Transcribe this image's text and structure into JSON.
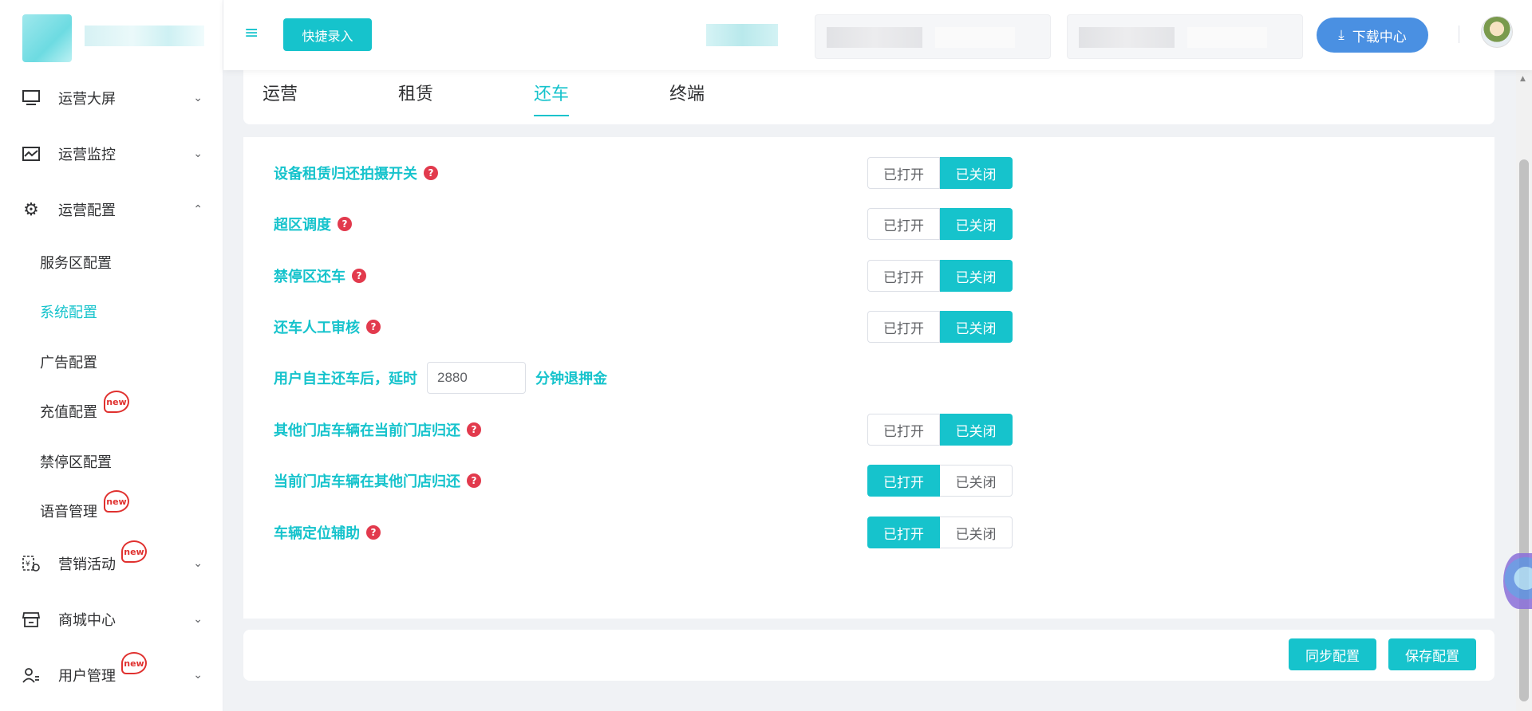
{
  "colors": {
    "accent": "#16c3cc",
    "download": "#4a90e2",
    "help": "#e23a4d",
    "new_badge": "#e0312f"
  },
  "sidebar": {
    "menus": [
      {
        "label": "运营大屏",
        "icon": "monitor-icon",
        "arrow": "chevron-down-icon"
      },
      {
        "label": "运营监控",
        "icon": "pulse-chart-icon",
        "arrow": "chevron-down-icon"
      },
      {
        "label": "运营配置",
        "icon": "gear-icon",
        "arrow": "chevron-up-icon",
        "expanded": true
      }
    ],
    "sub_items": [
      {
        "label": "服务区配置"
      },
      {
        "label": "系统配置",
        "active": true
      },
      {
        "label": "广告配置"
      },
      {
        "label": "充值配置",
        "badge": "new"
      },
      {
        "label": "禁停区配置"
      },
      {
        "label": "语音管理",
        "badge": "new"
      }
    ],
    "bottom_menus": [
      {
        "label": "营销活动",
        "icon": "coupon-gear-icon",
        "badge": "new"
      },
      {
        "label": "商城中心",
        "icon": "store-icon"
      },
      {
        "label": "用户管理",
        "icon": "user-list-icon",
        "badge": "new"
      }
    ]
  },
  "header": {
    "quick_entry": "快捷录入",
    "download": "下载中心"
  },
  "tabs": [
    {
      "label": "运营"
    },
    {
      "label": "租赁"
    },
    {
      "label": "还车",
      "active": true
    },
    {
      "label": "终端"
    }
  ],
  "toggle_labels": {
    "on": "已打开",
    "off": "已关闭"
  },
  "settings": [
    {
      "label": "设备租赁归还拍摄开关",
      "state": "off"
    },
    {
      "label": "超区调度",
      "state": "off"
    },
    {
      "label": "禁停区还车",
      "state": "off"
    },
    {
      "label": "还车人工审核",
      "state": "off"
    },
    {
      "label": "其他门店车辆在当前门店归还",
      "state": "off"
    },
    {
      "label": "当前门店车辆在其他门店归还",
      "state": "on"
    },
    {
      "label": "车辆定位辅助",
      "state": "on"
    }
  ],
  "refund_row": {
    "prefix": "用户自主还车后，延时",
    "value": "2880",
    "suffix": "分钟退押金"
  },
  "footer": {
    "sync": "同步配置",
    "save": "保存配置"
  }
}
